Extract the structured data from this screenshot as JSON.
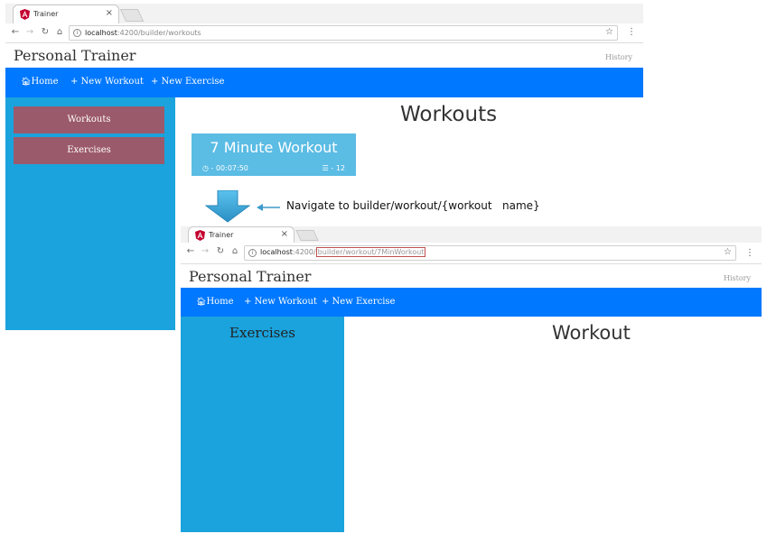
{
  "window1": {
    "tab_title": "Trainer",
    "url_host": "localhost",
    "url_path": ":4200/builder/workouts",
    "brand": "Personal Trainer",
    "history": "History",
    "nav": {
      "home": "Home",
      "new_workout": "+ New Workout",
      "new_exercise": "+ New Exercise"
    },
    "sidebar": {
      "workouts": "Workouts",
      "exercises": "Exercises"
    },
    "heading": "Workouts",
    "workout_card": {
      "title": "7 Minute Workout",
      "duration": "- 00:07:50",
      "count": "- 12"
    }
  },
  "annotation": {
    "text": "Navigate to builder/workout/{workout   name}"
  },
  "window2": {
    "tab_title": "Trainer",
    "url_host": "localhost",
    "url_port": ":4200/",
    "url_path_highlight": "builder/workout/7MinWorkout",
    "brand": "Personal Trainer",
    "history": "History",
    "nav": {
      "home": "Home",
      "new_workout": "+ New Workout",
      "new_exercise": "+ New Exercise"
    },
    "sidebar_heading": "Exercises",
    "heading": "Workout"
  },
  "colors": {
    "nav_blue": "#0078ff",
    "sidebar_blue": "#1aa3dd",
    "sidebar_button": "#9b5a6b",
    "tile_blue": "#5bbce4",
    "url_highlight_border": "#c0504d"
  },
  "icons": {
    "tab": "angular-icon",
    "back": "back-arrow-icon",
    "forward": "forward-arrow-icon",
    "reload": "reload-icon",
    "home": "home-icon",
    "info": "info-icon",
    "star": "bookmark-star-icon",
    "menu": "menu-dots-icon",
    "duration": "clock-icon",
    "exercises": "list-icon",
    "annotation_down": "down-arrow-icon",
    "annotation_left": "left-arrow-icon"
  }
}
